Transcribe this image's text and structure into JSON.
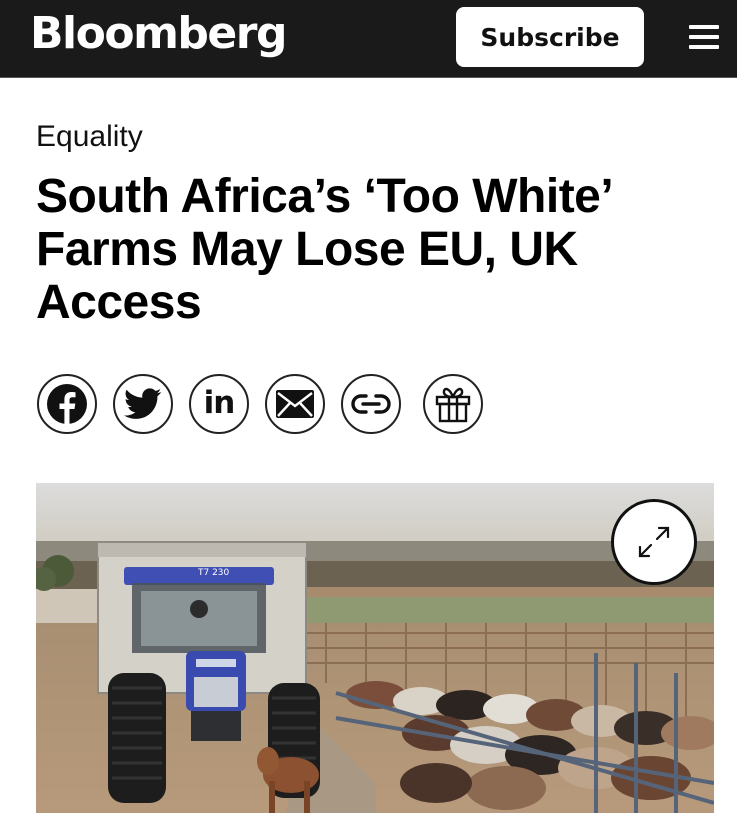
{
  "header": {
    "logo": "Bloomberg",
    "subscribe_label": "Subscribe",
    "menu_icon": "hamburger-menu-icon",
    "background": "#1a1a1a"
  },
  "article": {
    "category": "Equality",
    "headline": "South Africa’s ‘Too White’ Farms May Lose EU, UK Access"
  },
  "share_buttons": [
    {
      "icon": "facebook-icon"
    },
    {
      "icon": "twitter-icon"
    },
    {
      "icon": "linkedin-icon",
      "glyph": "in"
    },
    {
      "icon": "email-icon"
    },
    {
      "icon": "link-icon"
    },
    {
      "icon": "gift-icon"
    }
  ],
  "photo": {
    "tractor_text": "T7 230",
    "expand_icon": "expand-icon"
  }
}
